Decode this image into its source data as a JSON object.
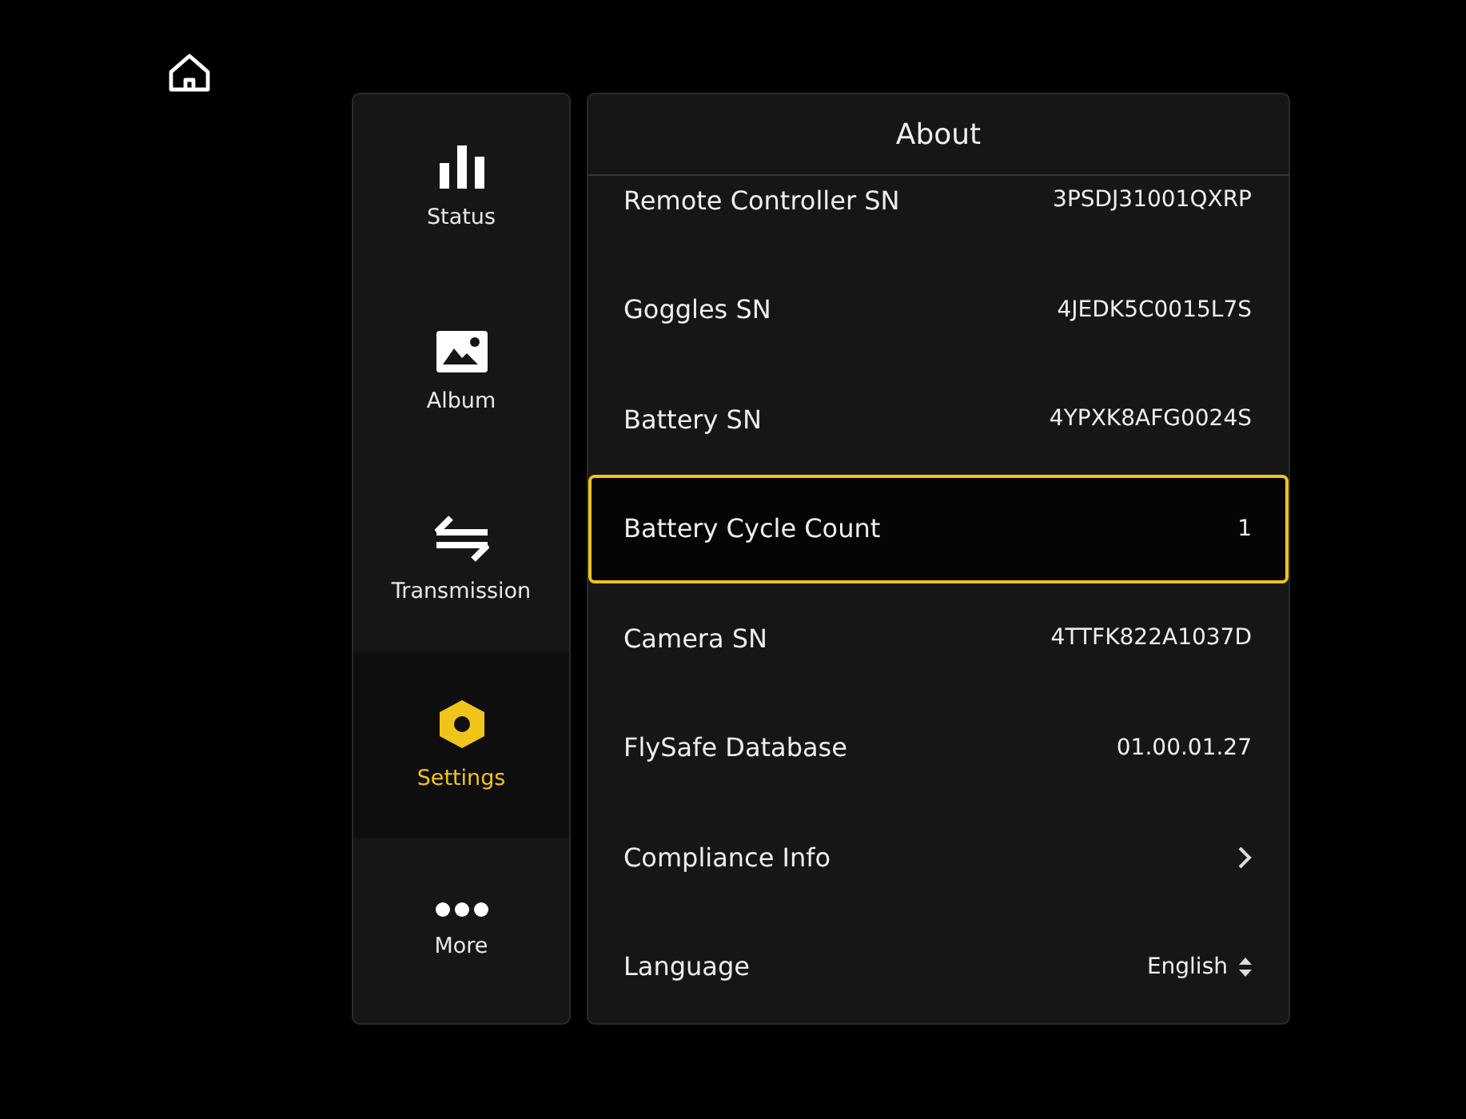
{
  "sidebar": {
    "items": [
      {
        "label": "Status",
        "kind": "bars",
        "selected": false
      },
      {
        "label": "Album",
        "kind": "image",
        "selected": false
      },
      {
        "label": "Transmission",
        "kind": "swap",
        "selected": false
      },
      {
        "label": "Settings",
        "kind": "hex",
        "selected": true
      },
      {
        "label": "More",
        "kind": "dots",
        "selected": false
      }
    ]
  },
  "panel": {
    "title": "About",
    "rows": [
      {
        "kind": "value",
        "label": "Remote Controller SN",
        "value": "3PSDJ31001QXRP",
        "selected": false
      },
      {
        "kind": "value",
        "label": "Goggles SN",
        "value": "4JEDK5C0015L7S",
        "selected": false
      },
      {
        "kind": "value",
        "label": "Battery SN",
        "value": "4YPXK8AFG0024S",
        "selected": false
      },
      {
        "kind": "value",
        "label": "Battery Cycle Count",
        "value": "1",
        "selected": true
      },
      {
        "kind": "value",
        "label": "Camera SN",
        "value": "4TTFK822A1037D",
        "selected": false
      },
      {
        "kind": "value",
        "label": "FlySafe Database",
        "value": "01.00.01.27",
        "selected": false
      },
      {
        "kind": "link",
        "label": "Compliance Info",
        "selected": false
      },
      {
        "kind": "dropdown",
        "label": "Language",
        "value": "English",
        "selected": false
      }
    ]
  }
}
